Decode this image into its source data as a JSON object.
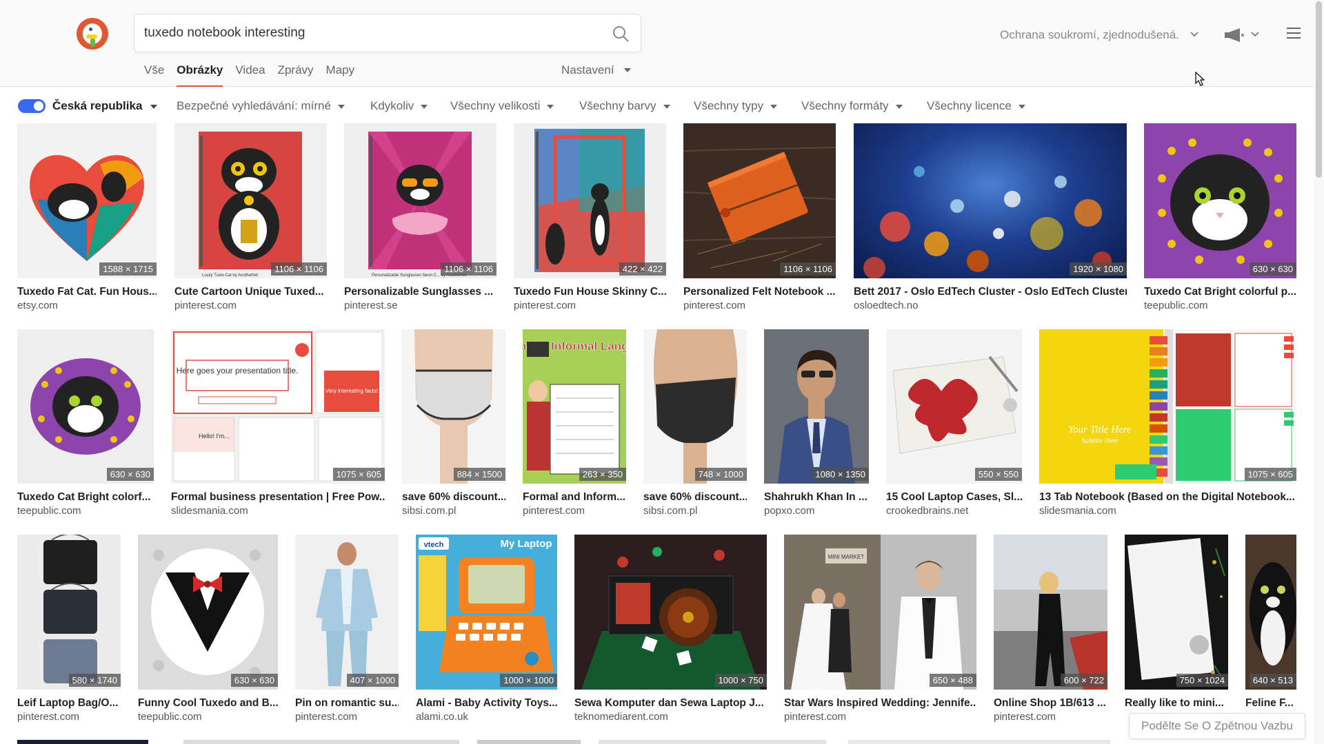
{
  "search": {
    "query": "tuxedo notebook interesting"
  },
  "header": {
    "privacy_label": "Ochrana soukromí, zjednodušená."
  },
  "tabs": [
    {
      "label": "Vše",
      "active": false
    },
    {
      "label": "Obrázky",
      "active": true
    },
    {
      "label": "Videa",
      "active": false
    },
    {
      "label": "Zprávy",
      "active": false
    },
    {
      "label": "Mapy",
      "active": false
    }
  ],
  "settings_label": "Nastavení",
  "filters": {
    "region": "Česká republika",
    "items": [
      "Bezpečné vyhledávání: mírné",
      "Kdykoliv",
      "Všechny velikosti",
      "Všechny barvy",
      "Všechny typy",
      "Všechny formáty",
      "Všechny licence"
    ]
  },
  "results": {
    "row1": [
      {
        "title": "Tuxedo Fat Cat. Fun Hous...",
        "source": "etsy.com",
        "dims": "1588 × 1715"
      },
      {
        "title": "Cute Cartoon Unique Tuxed...",
        "source": "pinterest.com",
        "dims": "1106 × 1106"
      },
      {
        "title": "Personalizable Sunglasses ...",
        "source": "pinterest.se",
        "dims": "1106 × 1106"
      },
      {
        "title": "Tuxedo Fun House Skinny C...",
        "source": "pinterest.com",
        "dims": "422 × 422"
      },
      {
        "title": "Personalized Felt Notebook ...",
        "source": "pinterest.com",
        "dims": "1106 × 1106"
      },
      {
        "title": "Bett 2017 - Oslo EdTech Cluster - Oslo EdTech Cluster",
        "source": "osloedtech.no",
        "dims": "1920 × 1080"
      },
      {
        "title": "Tuxedo Cat Bright colorful p...",
        "source": "teepublic.com",
        "dims": "630 × 630"
      }
    ],
    "row2": [
      {
        "title": "Tuxedo Cat Bright colorf...",
        "source": "teepublic.com",
        "dims": "630 × 630"
      },
      {
        "title": "Formal business presentation | Free Pow...",
        "source": "slidesmania.com",
        "dims": "1075 × 605"
      },
      {
        "title": "save 60% discount...",
        "source": "sibsi.com.pl",
        "dims": "884 × 1500"
      },
      {
        "title": "Formal and Inform...",
        "source": "pinterest.com",
        "dims": "263 × 350"
      },
      {
        "title": "save 60% discount...",
        "source": "sibsi.com.pl",
        "dims": "748 × 1000"
      },
      {
        "title": "Shahrukh Khan In ...",
        "source": "popxo.com",
        "dims": "1080 × 1350"
      },
      {
        "title": "15 Cool Laptop Cases, Sl...",
        "source": "crookedbrains.net",
        "dims": "550 × 550"
      },
      {
        "title": "13 Tab Notebook (Based on the Digital Notebook...",
        "source": "slidesmania.com",
        "dims": "1075 × 605"
      }
    ],
    "row3": [
      {
        "title": "Leif Laptop Bag/O...",
        "source": "pinterest.com",
        "dims": "580 × 1740"
      },
      {
        "title": "Funny Cool Tuxedo and B...",
        "source": "teepublic.com",
        "dims": "630 × 630"
      },
      {
        "title": "Pin on romantic su...",
        "source": "pinterest.com",
        "dims": "407 × 1000"
      },
      {
        "title": "Alami - Baby Activity Toys...",
        "source": "alami.co.uk",
        "dims": "1000 × 1000"
      },
      {
        "title": "Sewa Komputer dan Sewa Laptop J...",
        "source": "teknomediarent.com",
        "dims": "1000 × 750"
      },
      {
        "title": "Star Wars Inspired Wedding: Jennife...",
        "source": "pinterest.com",
        "dims": "650 × 488"
      },
      {
        "title": "Online Shop 1B/613 ...",
        "source": "pinterest.com",
        "dims": "600 × 722"
      },
      {
        "title": "Really like to mini...",
        "source": "",
        "dims": "750 × 1024"
      },
      {
        "title": "Feline F...",
        "source": "",
        "dims": "640 × 513"
      }
    ]
  },
  "image_texts": {
    "lucky": "Lucky Tuxie Cat by Anotherfelt",
    "sunglasses": "Personalizable Sunglasses Neon C... by Anotherfelt",
    "presentation_title": "Here goes your presentation title.",
    "presentation_facts": "Very interesting facts!",
    "presentation_hello": "Hello! I'm...",
    "formal_heading": "Formal & Informal Language",
    "notebook_title": "Your Title Here",
    "notebook_subtitle": "Subtitle Here",
    "my_laptop": "My Laptop",
    "vtech": "vtech",
    "mini_market": "MINI MARKET"
  },
  "feedback_label": "Podělte Se O Zpětnou Vazbu",
  "colors": {
    "accent": "#de5833",
    "toggle": "#3969ef"
  }
}
